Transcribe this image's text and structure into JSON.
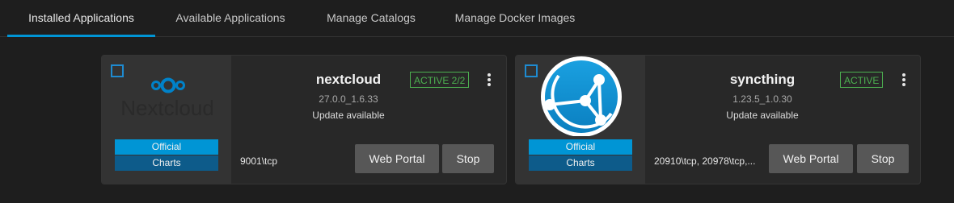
{
  "tabs": [
    {
      "label": "Installed Applications",
      "active": true
    },
    {
      "label": "Available Applications"
    },
    {
      "label": "Manage Catalogs"
    },
    {
      "label": "Manage Docker Images"
    }
  ],
  "apps": [
    {
      "name": "nextcloud",
      "logo_text": "Nextcloud",
      "version": "27.0.0_1.6.33",
      "update": "Update available",
      "status": "ACTIVE 2/2",
      "ports": "9001\\tcp",
      "badges": [
        "Official",
        "Charts"
      ],
      "buttons": {
        "portal": "Web Portal",
        "stop": "Stop"
      }
    },
    {
      "name": "syncthing",
      "version": "1.23.5_1.0.30",
      "update": "Update available",
      "status": "ACTIVE",
      "ports": "20910\\tcp, 20978\\tcp,...",
      "badges": [
        "Official",
        "Charts"
      ],
      "buttons": {
        "portal": "Web Portal",
        "stop": "Stop"
      }
    }
  ],
  "colors": {
    "accent": "#0095d5",
    "status_active": "#4caf50",
    "background": "#1e1e1e",
    "card": "#282828"
  }
}
